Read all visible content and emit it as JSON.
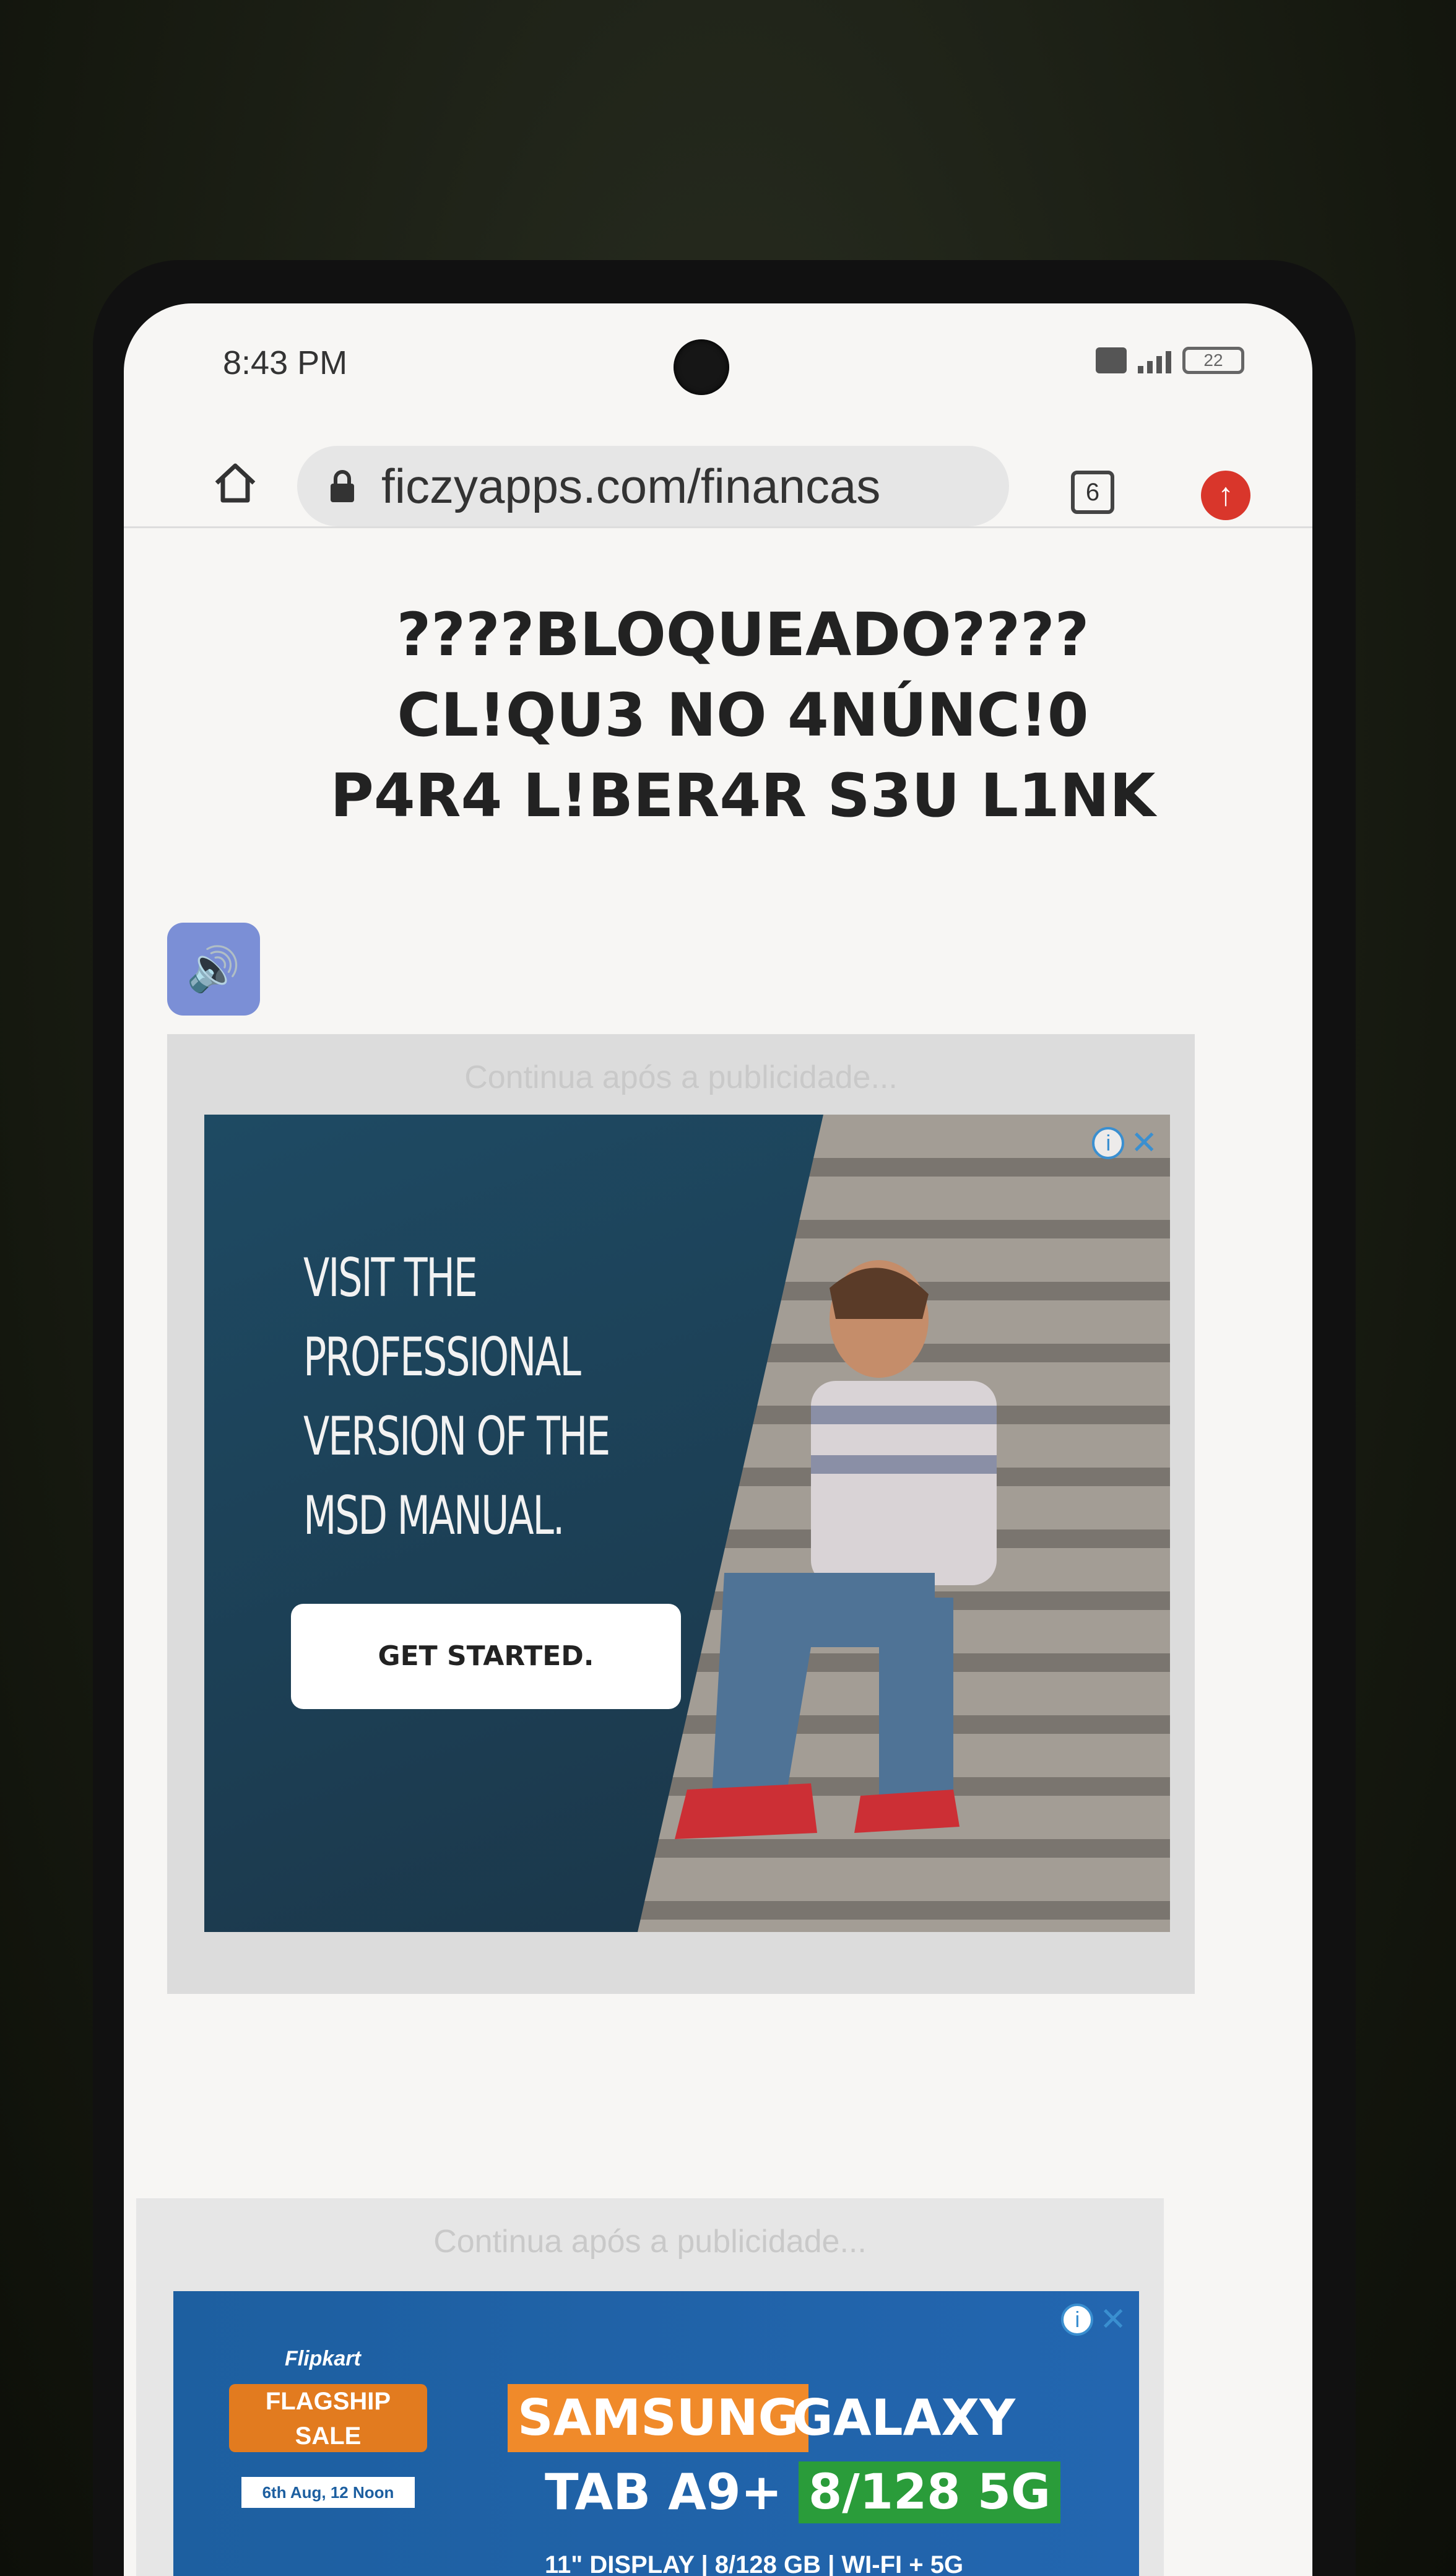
{
  "status_bar": {
    "time": "8:43 PM",
    "battery": "22",
    "icons": [
      "sim-icon",
      "signal-icon",
      "battery-icon"
    ]
  },
  "browser": {
    "url": "ficzyapps.com/financas",
    "tab_count": "6",
    "icons": [
      "home-icon",
      "lock-icon",
      "tabs-icon",
      "update-icon"
    ]
  },
  "page": {
    "headline_lines": [
      "????BLOQUEADO????",
      "CL!QU3 NO 4NÚNC!0",
      "P4R4 L!BER4R S3U L1NK"
    ],
    "audio_icon": "speaker-icon"
  },
  "ad1": {
    "caption": "Continua após a publicidade...",
    "heading_lines": [
      "VISIT THE",
      "PROFESSIONAL",
      "VERSION OF THE",
      "MSD MANUAL."
    ],
    "cta": "GET STARTED.",
    "colors": {
      "panel": "#1e4a63",
      "button": "#ffffff"
    }
  },
  "ad2": {
    "caption": "Continua após a publicidade...",
    "brand": "Flipkart",
    "badge_line1": "FLAGSHIP",
    "badge_line2": "SALE",
    "date": "6th Aug, 12 Noon",
    "samsung": "SAMSUNG",
    "galaxy": "GALAXY",
    "model": "TAB A9+",
    "spec_badge": "8/128 5G",
    "specs": "11\" DISPLAY | 8/128 GB | WI-FI + 5G",
    "colors": {
      "banner": "#1d5fa0",
      "samsung": "#f08a2a",
      "badge": "#2a9c3a"
    }
  }
}
